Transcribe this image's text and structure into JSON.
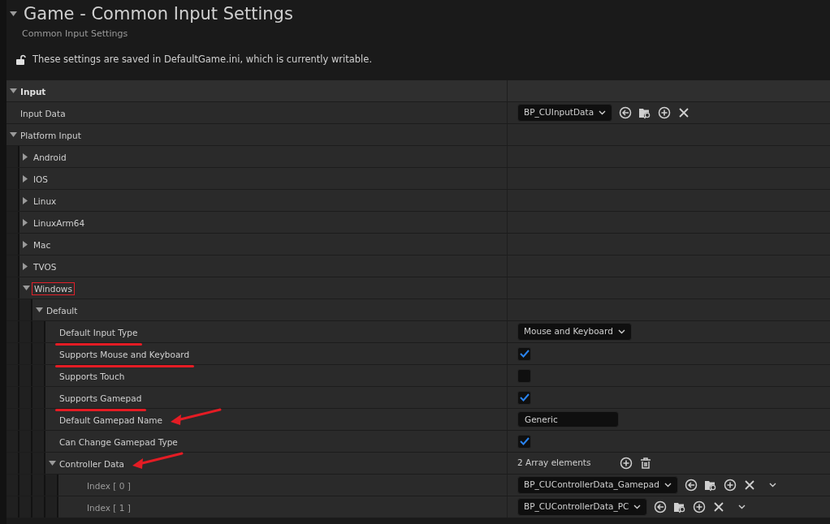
{
  "header": {
    "expanded": true,
    "title": "Game - Common Input Settings",
    "subtitle": "Common Input Settings",
    "notice": "These settings are saved in DefaultGame.ini, which is currently writable."
  },
  "rows": [
    {
      "kind": "category",
      "label": "Input",
      "expanded": true,
      "children": [
        {
          "kind": "property",
          "label": "Input Data",
          "value": {
            "kind": "asset",
            "text": "BP_CUInputData"
          }
        },
        {
          "kind": "property",
          "label": "Platform Input",
          "expanded": true,
          "children": [
            {
              "kind": "property",
              "label": "Android",
              "expanded": false
            },
            {
              "kind": "property",
              "label": "IOS",
              "expanded": false
            },
            {
              "kind": "property",
              "label": "Linux",
              "expanded": false
            },
            {
              "kind": "property",
              "label": "LinuxArm64",
              "expanded": false
            },
            {
              "kind": "property",
              "label": "Mac",
              "expanded": false
            },
            {
              "kind": "property",
              "label": "TVOS",
              "expanded": false
            },
            {
              "kind": "property",
              "label": "Windows",
              "expanded": true,
              "boxed": true,
              "children": [
                {
                  "kind": "property",
                  "label": "Default",
                  "expanded": true,
                  "children": [
                    {
                      "kind": "property",
                      "label": "Default Input Type",
                      "underlined": true,
                      "value": {
                        "kind": "dropdown",
                        "text": "Mouse and Keyboard"
                      }
                    },
                    {
                      "kind": "property",
                      "label": "Supports Mouse and Keyboard",
                      "underlined": true,
                      "value": {
                        "kind": "checkbox",
                        "checked": true
                      }
                    },
                    {
                      "kind": "property",
                      "label": "Supports Touch",
                      "value": {
                        "kind": "checkbox",
                        "checked": false
                      }
                    },
                    {
                      "kind": "property",
                      "label": "Supports Gamepad",
                      "underlined": true,
                      "value": {
                        "kind": "checkbox",
                        "checked": true
                      }
                    },
                    {
                      "kind": "property",
                      "label": "Default Gamepad Name",
                      "arrow": true,
                      "value": {
                        "kind": "text",
                        "text": "Generic"
                      }
                    },
                    {
                      "kind": "property",
                      "label": "Can Change Gamepad Type",
                      "value": {
                        "kind": "checkbox",
                        "checked": true
                      }
                    },
                    {
                      "kind": "property",
                      "label": "Controller Data",
                      "expanded": true,
                      "arrow": true,
                      "value": {
                        "kind": "array",
                        "text": "2 Array elements"
                      },
                      "children": [
                        {
                          "kind": "index",
                          "label": "Index [ 0 ]",
                          "value": {
                            "kind": "asset",
                            "text": "BP_CUControllerData_Gamepad",
                            "menu": true
                          }
                        },
                        {
                          "kind": "index",
                          "label": "Index [ 1 ]",
                          "value": {
                            "kind": "asset",
                            "text": "BP_CUControllerData_PC",
                            "menu": true
                          }
                        }
                      ]
                    }
                  ]
                }
              ]
            }
          ]
        }
      ]
    }
  ]
}
